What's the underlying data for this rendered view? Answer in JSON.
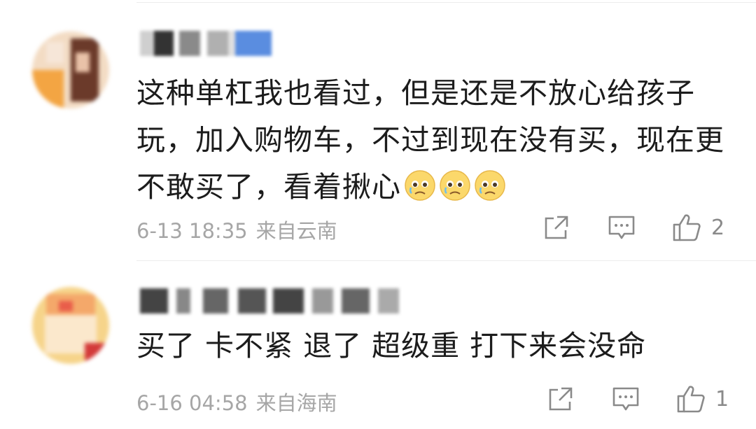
{
  "comments": [
    {
      "text": "这种单杠我也看过，但是还是不放心给孩子玩，加入购物车，不过到现在没有买，现在更不敢买了，看着揪心",
      "date": "6-13 18:35",
      "location": "来自云南",
      "likes": "2",
      "emoji_icon": "crying-face-icon",
      "emoji_count": 3
    },
    {
      "text": "买了 卡不紧 退了 超级重 打下来会没命",
      "date": "6-16 04:58",
      "location": "来自海南",
      "likes": "1"
    }
  ],
  "icons": [
    "share-icon",
    "comment-icon",
    "like-icon"
  ],
  "colors": {
    "text": "#1c1c1c",
    "meta": "#a6a6a6",
    "icon": "#8a8a8a",
    "divider": "#ececec"
  }
}
